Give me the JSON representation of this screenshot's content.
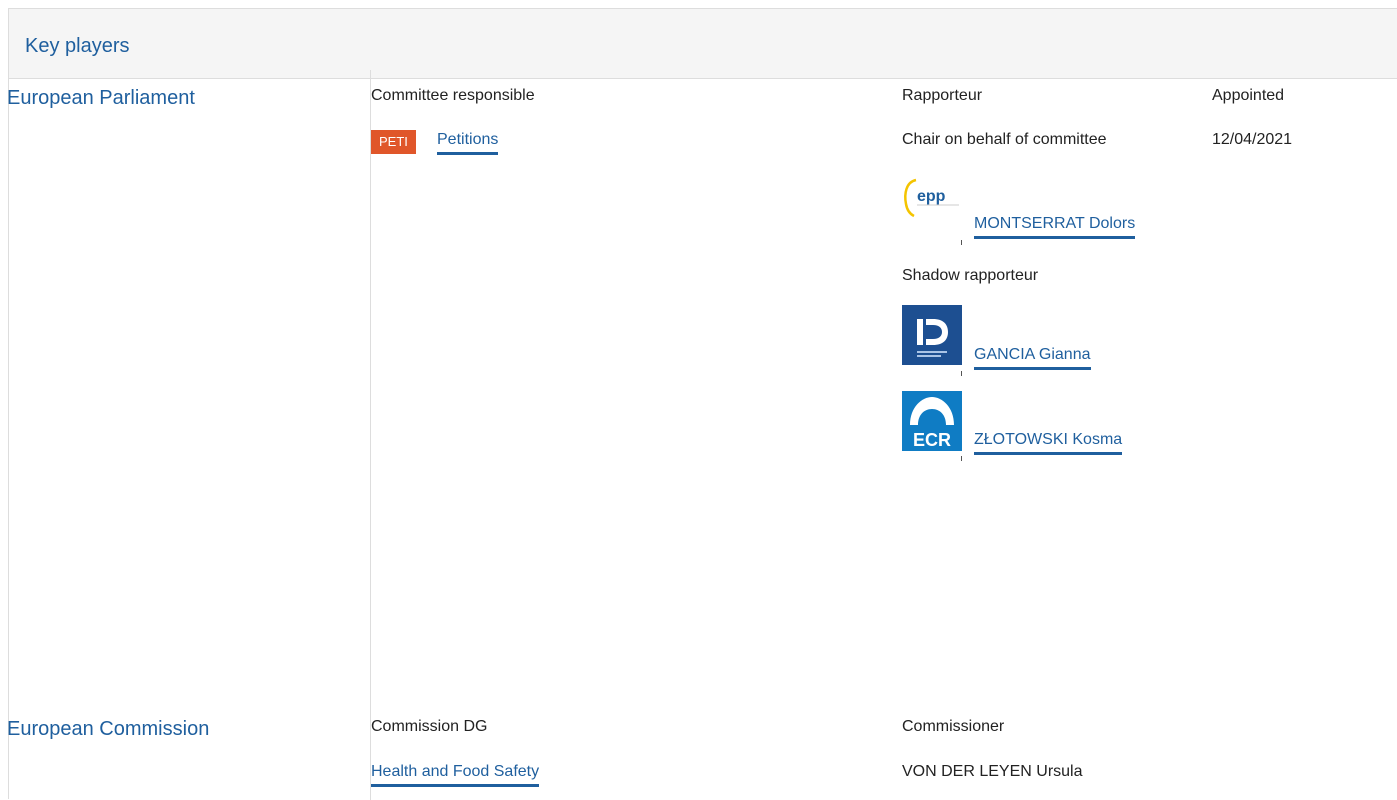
{
  "panel": {
    "title": "Key players"
  },
  "parliament": {
    "institution": "European Parliament",
    "committee_header": "Committee responsible",
    "rapporteur_header": "Rapporteur",
    "appointed_header": "Appointed",
    "committee_badge": "PETI",
    "committee_name": "Petitions",
    "chair_role": "Chair on behalf of committee",
    "appointed_date": "12/04/2021",
    "rapporteur": {
      "name": "MONTSERRAT Dolors",
      "group_logo": "epp-logo",
      "logo_text": "epp"
    },
    "shadow_header": "Shadow rapporteur",
    "shadows": [
      {
        "name": "GANCIA Gianna",
        "group_logo": "id-group-logo"
      },
      {
        "name": "ZŁOTOWSKI Kosma",
        "group_logo": "ecr-logo",
        "logo_text": "ECR"
      }
    ]
  },
  "commission": {
    "institution": "European Commission",
    "dg_header": "Commission DG",
    "commissioner_header": "Commissioner",
    "dg_name": "Health and Food Safety",
    "commissioner_name": "VON DER LEYEN Ursula"
  },
  "colors": {
    "link": "#1f5f9e",
    "badge": "#e0562a",
    "header_bg": "#f5f5f5",
    "border": "#dddddd"
  }
}
